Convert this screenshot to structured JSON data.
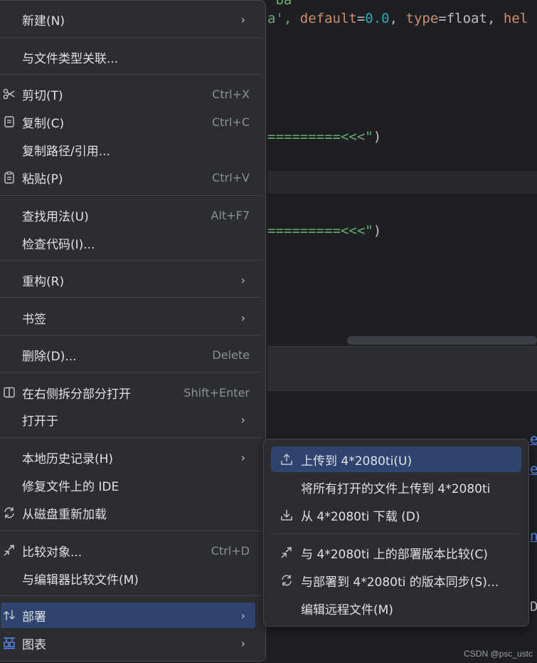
{
  "editor": {
    "line1_prefix": "a', ",
    "line1_kw1": "default",
    "line1_eq1": "=",
    "line1_num": "0.0",
    "line1_comma": ", ",
    "line1_kw2": "type",
    "line1_eq2": "=",
    "line1_type": "float",
    "line1_comma2": ", ",
    "line1_kw3": "hel",
    "line2_str": "=========<<<\"",
    "line2_close": ")",
    "line3_str": "=========<<<\"",
    "line3_close": ")",
    "console_links": [
      "e",
      "e",
      "n"
    ],
    "console_char": "D"
  },
  "menu": {
    "items": [
      {
        "label": "新建(N)",
        "shortcut": "",
        "submenu": true,
        "icon": ""
      },
      {
        "label": "与文件类型关联...",
        "shortcut": "",
        "submenu": false,
        "icon": ""
      },
      {
        "label": "剪切(T)",
        "shortcut": "Ctrl+X",
        "submenu": false,
        "icon": "scissors-icon"
      },
      {
        "label": "复制(C)",
        "shortcut": "Ctrl+C",
        "submenu": false,
        "icon": "copy-icon"
      },
      {
        "label": "复制路径/引用...",
        "shortcut": "",
        "submenu": false,
        "icon": ""
      },
      {
        "label": "粘贴(P)",
        "shortcut": "Ctrl+V",
        "submenu": false,
        "icon": "clipboard-icon"
      },
      {
        "label": "查找用法(U)",
        "shortcut": "Alt+F7",
        "submenu": false,
        "icon": ""
      },
      {
        "label": "检查代码(I)...",
        "shortcut": "",
        "submenu": false,
        "icon": ""
      },
      {
        "label": "重构(R)",
        "shortcut": "",
        "submenu": true,
        "icon": ""
      },
      {
        "label": "书签",
        "shortcut": "",
        "submenu": true,
        "icon": ""
      },
      {
        "label": "删除(D)...",
        "shortcut": "Delete",
        "submenu": false,
        "icon": ""
      },
      {
        "label": "在右侧拆分部分打开",
        "shortcut": "Shift+Enter",
        "submenu": false,
        "icon": "split-icon"
      },
      {
        "label": "打开于",
        "shortcut": "",
        "submenu": true,
        "icon": ""
      },
      {
        "label": "本地历史记录(H)",
        "shortcut": "",
        "submenu": true,
        "icon": ""
      },
      {
        "label": "修复文件上的 IDE",
        "shortcut": "",
        "submenu": false,
        "icon": ""
      },
      {
        "label": "从磁盘重新加载",
        "shortcut": "",
        "submenu": false,
        "icon": "reload-icon"
      },
      {
        "label": "比较对象...",
        "shortcut": "Ctrl+D",
        "submenu": false,
        "icon": "compare-icon"
      },
      {
        "label": "与编辑器比较文件(M)",
        "shortcut": "",
        "submenu": false,
        "icon": ""
      },
      {
        "label": "部署",
        "shortcut": "",
        "submenu": true,
        "icon": "deploy-icon"
      },
      {
        "label": "图表",
        "shortcut": "",
        "submenu": true,
        "icon": "diagram-icon"
      }
    ]
  },
  "submenu": {
    "items": [
      {
        "label": "上传到 4*2080ti(U)",
        "icon": "upload-icon"
      },
      {
        "label": "将所有打开的文件上传到 4*2080ti",
        "icon": ""
      },
      {
        "label": "从 4*2080ti 下载 (D)",
        "icon": "download-icon"
      },
      {
        "label": "与 4*2080ti 上的部署版本比较(C)",
        "icon": "compare-icon"
      },
      {
        "label": "与部署到 4*2080ti 的版本同步(S)...",
        "icon": "sync-icon"
      },
      {
        "label": "编辑远程文件(M)",
        "icon": ""
      }
    ]
  },
  "watermark": "CSDN @psc_ustc"
}
